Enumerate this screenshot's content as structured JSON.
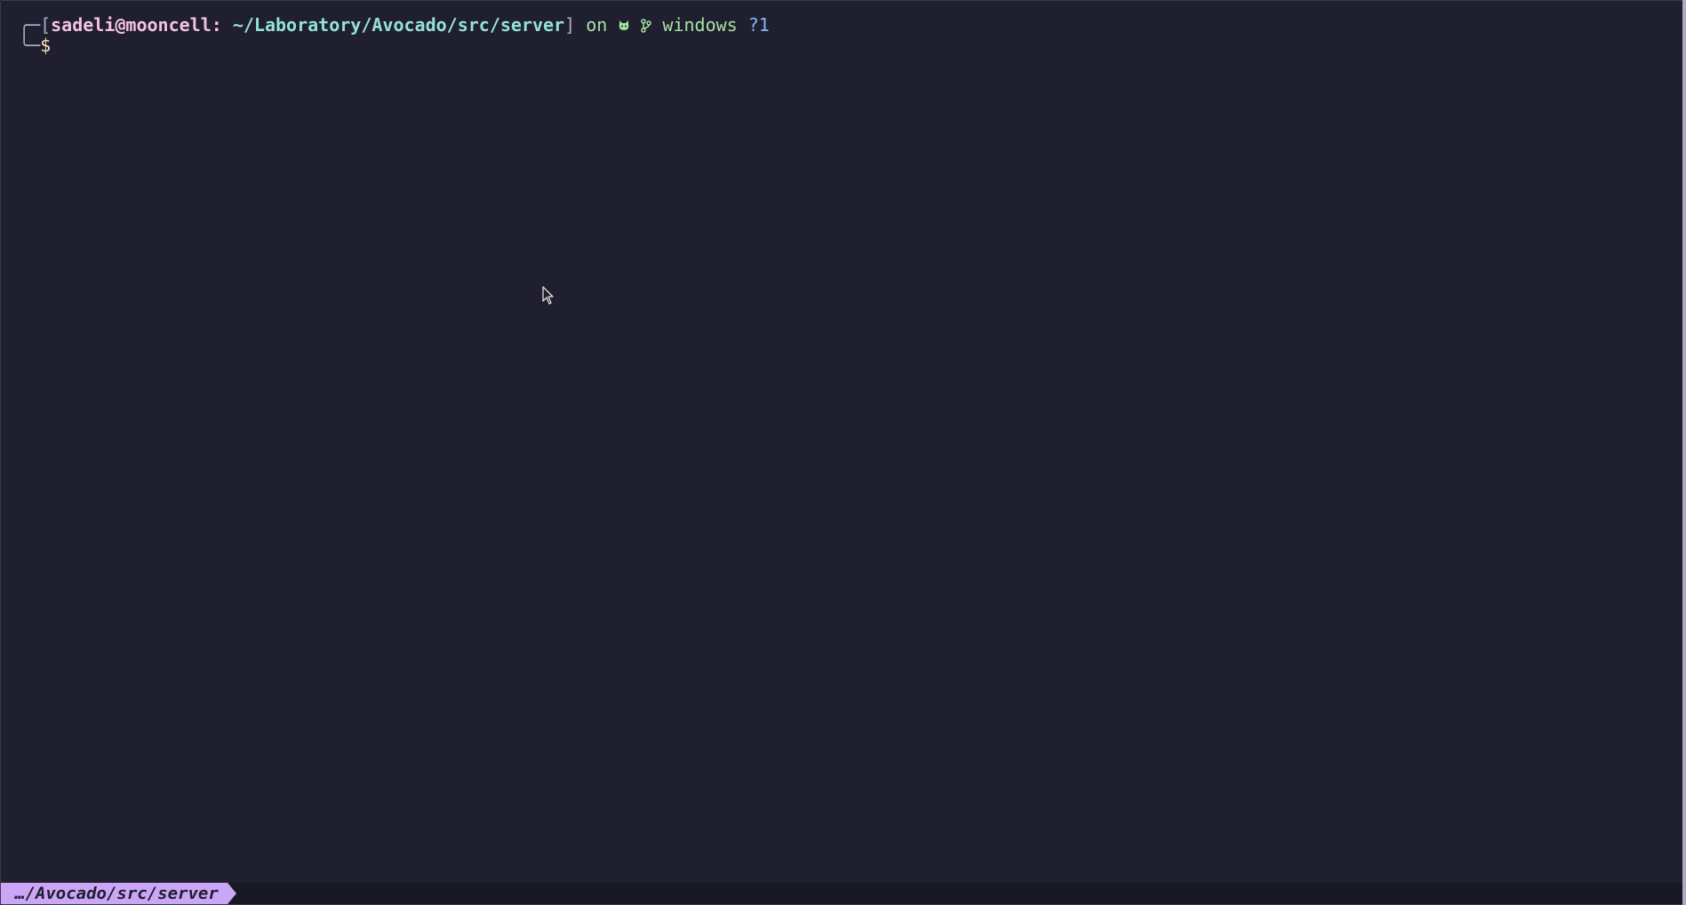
{
  "prompt": {
    "box_top": "╭─[",
    "user_host": "sadeli@mooncell:",
    "space": " ",
    "path": "~/Laboratory/Avocado/src/server",
    "close_bracket": "]",
    "on": " on ",
    "git_icon": "🐈",
    "branch_icon": "",
    "branch": " windows",
    "status": " ?1",
    "box_bottom": "╰─",
    "dollar": "$"
  },
  "statusbar": {
    "path": "…/Avocado/src/server"
  },
  "icons": {
    "git": "github-cat-icon",
    "branch": "git-branch-icon",
    "pointer": "mouse-pointer-icon"
  },
  "colors": {
    "background": "#1f1f2f",
    "user": "#f5c2e7",
    "path": "#94e2d5",
    "branch": "#a6e3a1",
    "status": "#89b4fa",
    "statusbar_accent": "#cba6f7"
  }
}
